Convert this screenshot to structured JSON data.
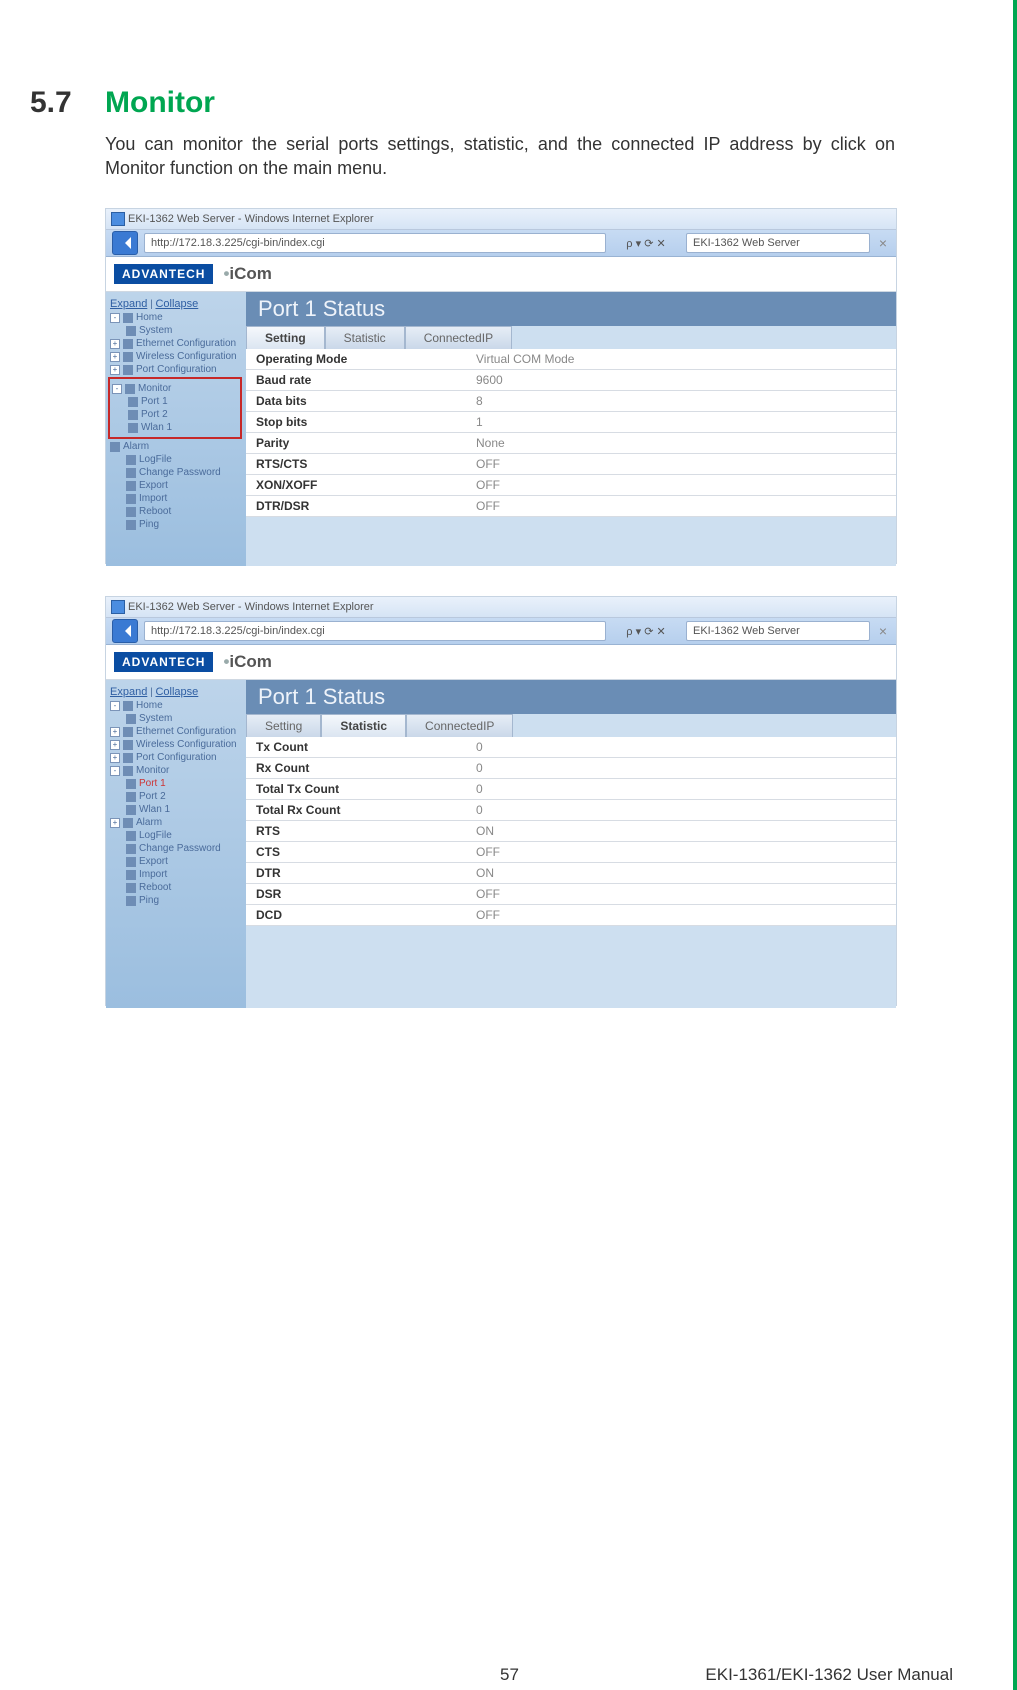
{
  "section_number": "5.7",
  "section_title": "Monitor",
  "body_text": "You can monitor the serial ports settings, statistic, and the connected IP address by click on Monitor function on the main menu.",
  "footer": {
    "page_number": "57",
    "manual": "EKI-1361/EKI-1362 User Manual"
  },
  "screenshot1": {
    "window_title": "EKI-1362 Web Server - Windows Internet Explorer",
    "url": "http://172.18.3.225/cgi-bin/index.cgi",
    "url_right": "ρ ▾ ⟳ ✕",
    "tab_label": "EKI-1362 Web Server",
    "tab_close": "×",
    "logo_brand": "ADVANTECH",
    "logo_product": "iCom",
    "sidebar": {
      "head_expand": "Expand",
      "head_sep": " | ",
      "head_collapse": "Collapse",
      "items": [
        {
          "label": "Home"
        },
        {
          "label": "System",
          "sub": true
        },
        {
          "label": "Ethernet Configuration",
          "plus": true
        },
        {
          "label": "Wireless Configuration",
          "plus": true
        },
        {
          "label": "Port Configuration",
          "plus": true
        }
      ],
      "monitor_group": {
        "label": "Monitor",
        "children": [
          {
            "label": "Port 1"
          },
          {
            "label": "Port 2"
          },
          {
            "label": "Wlan 1"
          }
        ]
      },
      "items2": [
        {
          "label": "Alarm"
        },
        {
          "label": "LogFile"
        },
        {
          "label": "Change Password"
        },
        {
          "label": "Export"
        },
        {
          "label": "Import"
        },
        {
          "label": "Reboot"
        },
        {
          "label": "Ping"
        }
      ]
    },
    "content_title": "Port 1 Status",
    "tabs": [
      "Setting",
      "Statistic",
      "ConnectedIP"
    ],
    "rows": [
      {
        "k": "Operating Mode",
        "v": "Virtual COM Mode"
      },
      {
        "k": "Baud rate",
        "v": "9600"
      },
      {
        "k": "Data bits",
        "v": "8"
      },
      {
        "k": "Stop bits",
        "v": "1"
      },
      {
        "k": "Parity",
        "v": "None"
      },
      {
        "k": "RTS/CTS",
        "v": "OFF"
      },
      {
        "k": "XON/XOFF",
        "v": "OFF"
      },
      {
        "k": "DTR/DSR",
        "v": "OFF"
      }
    ]
  },
  "screenshot2": {
    "window_title": "EKI-1362 Web Server - Windows Internet Explorer",
    "url": "http://172.18.3.225/cgi-bin/index.cgi",
    "url_right": "ρ ▾ ⟳ ✕",
    "tab_label": "EKI-1362 Web Server",
    "tab_close": "×",
    "logo_brand": "ADVANTECH",
    "logo_product": "iCom",
    "sidebar": {
      "head_expand": "Expand",
      "head_sep": " | ",
      "head_collapse": "Collapse",
      "items": [
        {
          "label": "Home"
        },
        {
          "label": "System",
          "sub": true
        },
        {
          "label": "Ethernet Configuration",
          "plus": true
        },
        {
          "label": "Wireless Configuration",
          "plus": true
        },
        {
          "label": "Port Configuration",
          "plus": true
        }
      ],
      "monitor_group": {
        "label": "Monitor",
        "children": [
          {
            "label": "Port 1"
          },
          {
            "label": "Port 2"
          },
          {
            "label": "Wlan 1"
          }
        ]
      },
      "items2": [
        {
          "label": "Alarm",
          "plus": true
        },
        {
          "label": "LogFile"
        },
        {
          "label": "Change Password"
        },
        {
          "label": "Export"
        },
        {
          "label": "Import"
        },
        {
          "label": "Reboot"
        },
        {
          "label": "Ping"
        }
      ]
    },
    "content_title": "Port 1 Status",
    "tabs": [
      "Setting",
      "Statistic",
      "ConnectedIP"
    ],
    "rows": [
      {
        "k": "Tx Count",
        "v": "0"
      },
      {
        "k": "Rx Count",
        "v": "0"
      },
      {
        "k": "Total Tx Count",
        "v": "0"
      },
      {
        "k": "Total Rx Count",
        "v": "0"
      },
      {
        "k": "RTS",
        "v": "ON"
      },
      {
        "k": "CTS",
        "v": "OFF"
      },
      {
        "k": "DTR",
        "v": "ON"
      },
      {
        "k": "DSR",
        "v": "OFF"
      },
      {
        "k": "DCD",
        "v": "OFF"
      }
    ]
  }
}
